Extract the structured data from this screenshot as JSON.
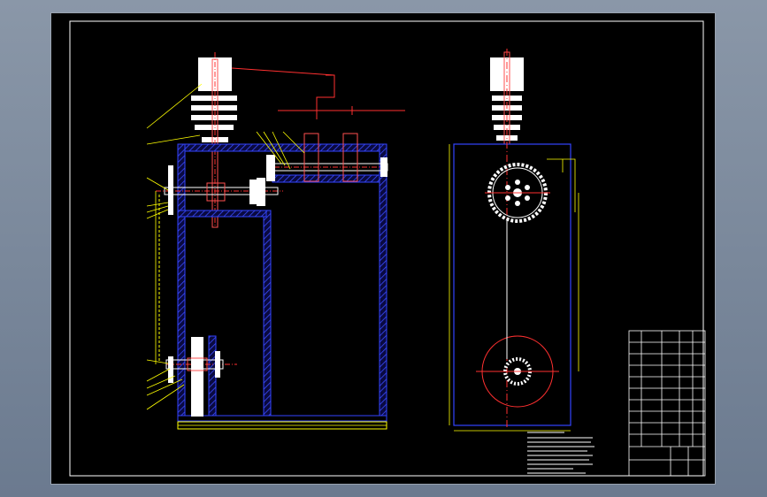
{
  "document": {
    "type": "mechanical assembly drawing",
    "background_color": "#000000",
    "frame_color": "#ffffff",
    "housing_color": "#3344ff",
    "centerline_color": "#ff3030",
    "leader_color": "#ffff00",
    "shaft_color": "#ffffff",
    "hatch_color": "#2233cc",
    "gear_color": "#ffffff"
  },
  "views": [
    {
      "id": "front-section",
      "description_icon": "section-view"
    },
    {
      "id": "side-view",
      "description_icon": "elevation-view"
    }
  ],
  "notes_icon": "technical-requirements-text-block",
  "title_block_icon": "title-block-table"
}
